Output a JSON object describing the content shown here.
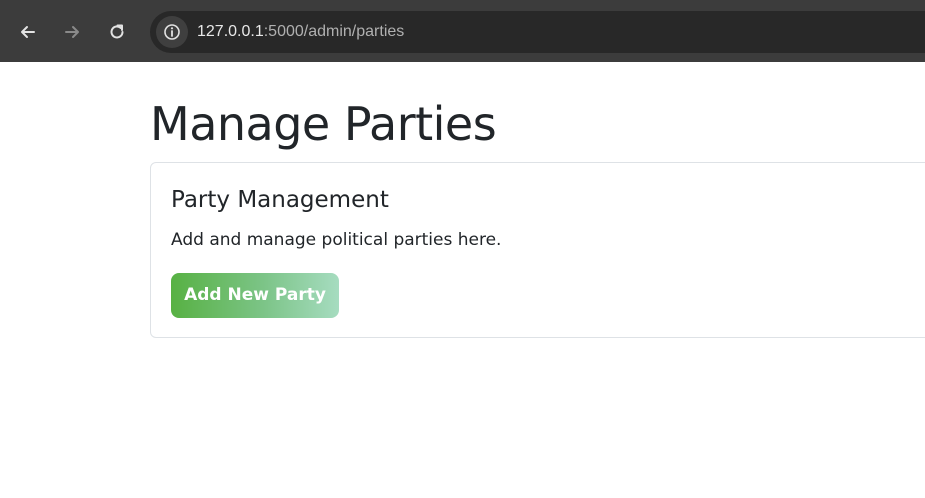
{
  "browser": {
    "url_host": "127.0.0.1",
    "url_path": ":5000/admin/parties",
    "icons": {
      "back": "arrow-left-icon",
      "forward": "arrow-right-icon",
      "reload": "reload-icon",
      "site_info": "info-icon"
    }
  },
  "page": {
    "title": "Manage Parties"
  },
  "card": {
    "title": "Party Management",
    "text": "Add and manage political parties here.",
    "button_label": "Add New Party"
  },
  "colors": {
    "browser_bar": "#3c3c3c",
    "omnibox": "#282828",
    "text_dark": "#212529",
    "card_border": "#dee2e6",
    "button_gradient_start": "#57b143",
    "button_gradient_end": "#a6dcc0"
  }
}
